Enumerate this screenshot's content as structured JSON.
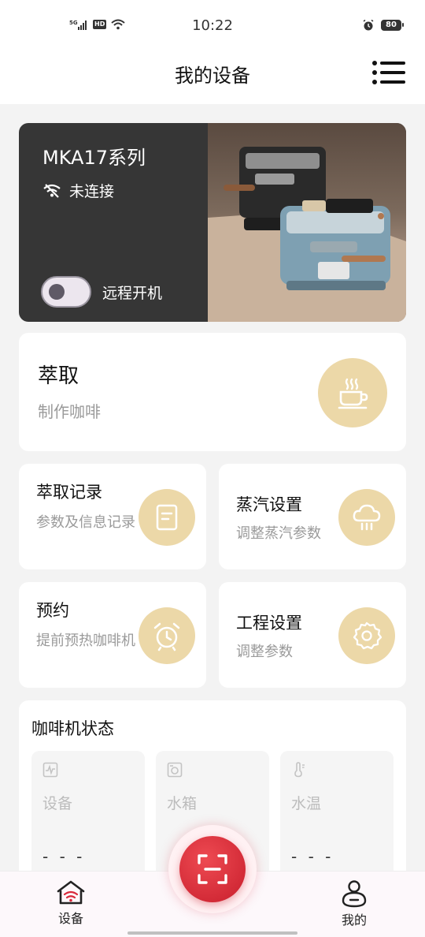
{
  "status_bar": {
    "time": "10:22",
    "network": "5G",
    "hd": "HD",
    "battery": "80"
  },
  "header": {
    "title": "我的设备"
  },
  "device": {
    "name": "MKA17系列",
    "connection": "未连接",
    "remote_power_label": "远程开机",
    "remote_power_on": false
  },
  "brew": {
    "title": "萃取",
    "subtitle": "制作咖啡"
  },
  "features": [
    {
      "title": "萃取记录",
      "subtitle": "参数及信息记录",
      "icon": "document-icon"
    },
    {
      "title": "蒸汽设置",
      "subtitle": "调整蒸汽参数",
      "icon": "steam-cloud-icon"
    },
    {
      "title": "预约",
      "subtitle": "提前预热咖啡机",
      "icon": "alarm-clock-icon"
    },
    {
      "title": "工程设置",
      "subtitle": "调整参数",
      "icon": "gear-icon"
    }
  ],
  "machine_status": {
    "title": "咖啡机状态",
    "items": [
      {
        "label": "设备",
        "value": "- - -",
        "icon": "pulse-icon"
      },
      {
        "label": "水箱",
        "value": "",
        "icon": "water-tank-icon"
      },
      {
        "label": "水温",
        "value": "- - -",
        "icon": "thermometer-icon"
      }
    ]
  },
  "nav": {
    "devices_label": "设备",
    "mine_label": "我的"
  },
  "colors": {
    "accent_icon_bg": "#ecd8a8",
    "scan_red": "#d8283a",
    "card_dark": "#363636",
    "page_bg": "#f3f3f3"
  }
}
